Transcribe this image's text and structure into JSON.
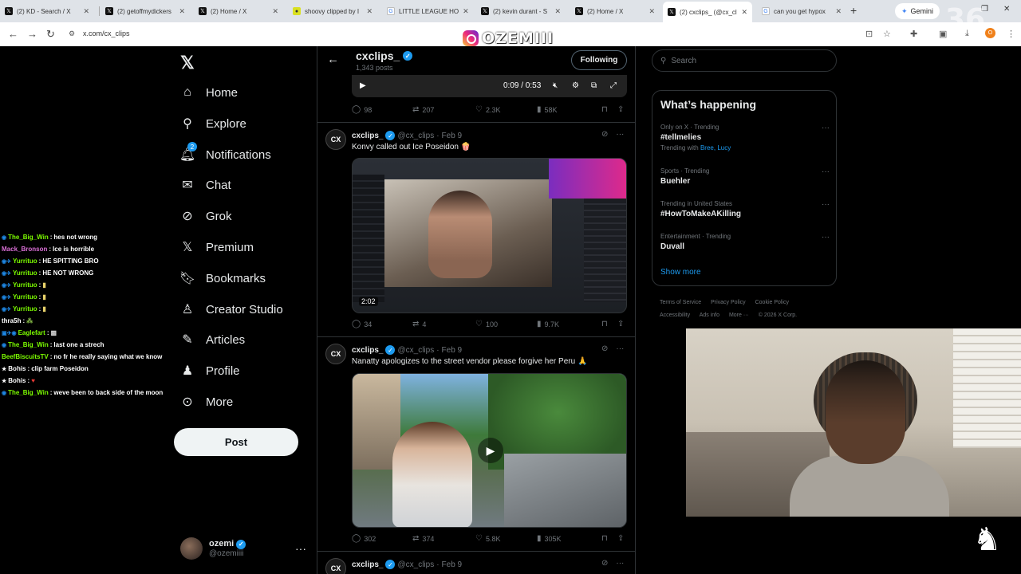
{
  "browser": {
    "tabs": [
      {
        "label": "(2) KD - Search / X",
        "icon": "x-logo-icon"
      },
      {
        "label": "(2) getoffmydickers",
        "icon": "x-logo-icon"
      },
      {
        "label": "(2) Home / X",
        "icon": "x-logo-icon"
      },
      {
        "label": "shoovy clipped by I",
        "icon": "clip-icon"
      },
      {
        "label": "LITTLE LEAGUE HO",
        "icon": "google-icon"
      },
      {
        "label": "(2) kevin durant - S",
        "icon": "x-logo-icon"
      },
      {
        "label": "(2) Home / X",
        "icon": "x-logo-icon"
      },
      {
        "label": "(2) cxclips_ (@cx_cl",
        "icon": "x-logo-icon",
        "active": true
      },
      {
        "label": "can you get hypox",
        "icon": "google-icon"
      }
    ],
    "gemini_label": "Gemini",
    "url": "x.com/cx_clips",
    "profile_initial": "O"
  },
  "overlay": {
    "watermark": "OZEMIII",
    "corner_number": "36"
  },
  "nav": {
    "items": [
      {
        "label": "Home",
        "icon": "home-icon"
      },
      {
        "label": "Explore",
        "icon": "search-icon"
      },
      {
        "label": "Notifications",
        "icon": "bell-icon",
        "badge": "2"
      },
      {
        "label": "Chat",
        "icon": "mail-icon"
      },
      {
        "label": "Grok",
        "icon": "grok-icon"
      },
      {
        "label": "Premium",
        "icon": "x-logo-icon"
      },
      {
        "label": "Bookmarks",
        "icon": "bookmark-icon"
      },
      {
        "label": "Creator Studio",
        "icon": "creator-studio-icon"
      },
      {
        "label": "Articles",
        "icon": "article-icon"
      },
      {
        "label": "Profile",
        "icon": "person-icon"
      },
      {
        "label": "More",
        "icon": "more-circle-icon"
      }
    ],
    "post_label": "Post",
    "account": {
      "name": "ozemi",
      "handle": "@ozemiiii"
    }
  },
  "chat": [
    {
      "user": "The_Big_Win",
      "msg": "hes not wrong",
      "color": "#7cfc00"
    },
    {
      "user": "Mack_Bronson",
      "msg": "Ice is horrible",
      "color": "#da70d6"
    },
    {
      "user": "Yurrituo",
      "msg": "HE SPITTING BRO",
      "color": "#7cfc00"
    },
    {
      "user": "Yurrituo",
      "msg": "HE NOT WRONG",
      "color": "#7cfc00"
    },
    {
      "user": "Yurrituo",
      "msg": "",
      "color": "#7cfc00"
    },
    {
      "user": "Yurrituo",
      "msg": "",
      "color": "#7cfc00"
    },
    {
      "user": "Yurrituo",
      "msg": "",
      "color": "#7cfc00"
    },
    {
      "user": "thra5h",
      "msg": "",
      "color": "#ffffff"
    },
    {
      "user": "Eaglefart",
      "msg": "",
      "color": "#7cfc00"
    },
    {
      "user": "The_Big_Win",
      "msg": "last one a strech",
      "color": "#7cfc00"
    },
    {
      "user": "BeefBiscuitsTV",
      "msg": "no fr he really saying what we know",
      "color": "#7cfc00"
    },
    {
      "user": "Bohis",
      "msg": "clip farm Poseidon",
      "color": "#ffffff"
    },
    {
      "user": "Bohis",
      "msg": "",
      "color": "#ffffff"
    },
    {
      "user": "The_Big_Win",
      "msg": "weve been to back side of the moon",
      "color": "#7cfc00"
    }
  ],
  "profile_header": {
    "name": "cxclips_",
    "posts": "1,343 posts",
    "following_label": "Following"
  },
  "top_video": {
    "time": "0:09 / 0:53",
    "stats": {
      "replies": "98",
      "reposts": "207",
      "likes": "2.3K",
      "views": "58K"
    }
  },
  "tweets": [
    {
      "name": "cxclips_",
      "handle": "@cx_clips",
      "date": "Feb 9",
      "text": "Konvy called out Ice Poseidon 🍿",
      "duration": "2:02",
      "stats": {
        "replies": "34",
        "reposts": "4",
        "likes": "100",
        "views": "9.7K"
      }
    },
    {
      "name": "cxclips_",
      "handle": "@cx_clips",
      "date": "Feb 9",
      "text": "Nanatty apologizes to the street vendor please forgive her Peru 🙏",
      "stats": {
        "replies": "302",
        "reposts": "374",
        "likes": "5.8K",
        "views": "305K"
      }
    },
    {
      "name": "cxclips_",
      "handle": "@cx_clips",
      "date": "Feb 9"
    }
  ],
  "sidebar": {
    "search_placeholder": "Search",
    "trends_title": "What’s happening",
    "trends": [
      {
        "context": "Only on X · Trending",
        "title": "#tellmelies",
        "with_label": "Trending with",
        "with": "Bree, Lucy"
      },
      {
        "context": "Sports · Trending",
        "title": "Buehler"
      },
      {
        "context": "Trending in United States",
        "title": "#HowToMakeAKilling"
      },
      {
        "context": "Entertainment · Trending",
        "title": "Duvall"
      }
    ],
    "show_more": "Show more",
    "footer": [
      "Terms of Service",
      "Privacy Policy",
      "Cookie Policy",
      "Accessibility",
      "Ads info",
      "More ···",
      "© 2026 X Corp."
    ]
  },
  "colors": {
    "accent": "#1d9bf0",
    "bg": "#000000",
    "text": "#e7e9ea",
    "muted": "#71767b"
  }
}
